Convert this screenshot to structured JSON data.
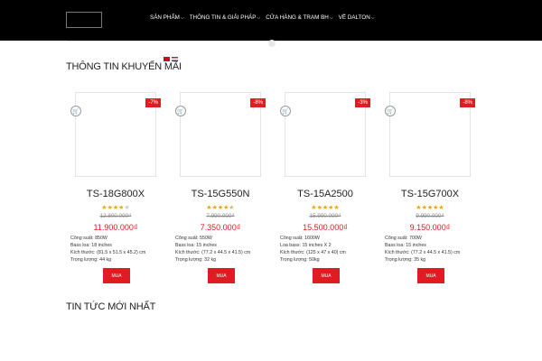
{
  "header": {
    "nav": [
      {
        "label": "SẢN PHẨM",
        "icon": "chevron-down-icon"
      },
      {
        "label": "THÔNG TIN & GIẢI PHÁP",
        "icon": "chevron-down-icon"
      },
      {
        "label": "CỬA HÀNG & TRẠM BH",
        "icon": "chevron-down-icon"
      },
      {
        "label": "VỀ DALTON",
        "icon": "chevron-down-icon"
      }
    ]
  },
  "promo": {
    "title": "THÔNG TIN KHUYẾN MÃI"
  },
  "news": {
    "title": "TIN TỨC MỚI NHẤT"
  },
  "colors": {
    "accent": "#e01b24",
    "star": "#f0a500",
    "topbar": "#000000"
  },
  "products": [
    {
      "name": "TS-18G800X",
      "badge": "-7%",
      "rating": 4,
      "old_price": "12.800.000₫",
      "price": "11.900.000₫",
      "specs": [
        "Công suất: 850W",
        "Bass loa: 18 inches",
        "Kích thước: (81.5 x 51.5 x 45.2) cm",
        "Trọng lượng: 44 kg"
      ],
      "buy": "MUA"
    },
    {
      "name": "TS-15G550N",
      "badge": "-8%",
      "rating": 4.5,
      "old_price": "7.990.000₫",
      "price": "7.350.000₫",
      "specs": [
        "Công suất: 550W",
        "Bass loa: 15 inches",
        "Kích thước: (77.2 x 44.5 x 41.5) cm",
        "Trọng lượng: 32 kg"
      ],
      "buy": "MUA"
    },
    {
      "name": "TS-15A2500",
      "badge": "-3%",
      "rating": 5,
      "old_price": "15.900.000₫",
      "price": "15.500.000₫",
      "specs": [
        "Công suất: 1600W",
        "Loa bass: 15 inches X 2",
        "Kích thước: (125 x 47 x 40) cm",
        "Trọng lượng: 50kg"
      ],
      "buy": "MUA"
    },
    {
      "name": "TS-15G700X",
      "badge": "-8%",
      "rating": 5,
      "old_price": "9.990.000₫",
      "price": "9.150.000₫",
      "specs": [
        "Công suất: 700W",
        "Bass loa: 15 inches",
        "Kích thước: (77.2 x 44.5 x 41.5) cm",
        "Trọng lượng: 35 kg"
      ],
      "buy": "MUA"
    }
  ]
}
